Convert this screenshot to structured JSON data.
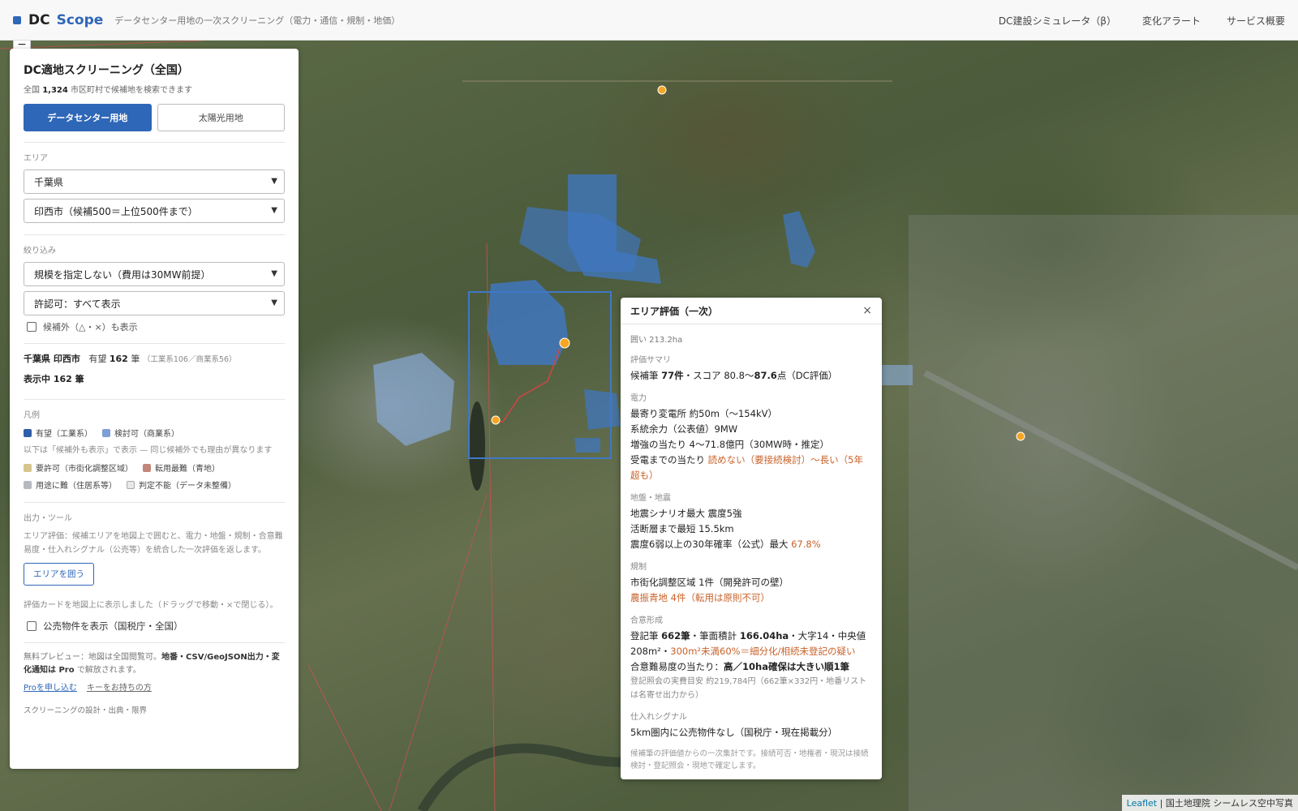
{
  "header": {
    "logo_dc": "DC",
    "logo_scope": "Scope",
    "tagline": "データセンター用地の一次スクリーニング（電力・通信・規制・地価）",
    "nav": [
      "DC建設シミュレータ（β）",
      "変化アラート",
      "サービス概要"
    ],
    "accent_color": "#2f67b8"
  },
  "map": {
    "zoom_minus": "−",
    "attribution_leaflet": "Leaflet",
    "attribution_rest": " | 国土地理院 シームレス空中写真"
  },
  "panel": {
    "title": "DC適地スクリーニング（全国）",
    "subtitle_prefix": "全国",
    "subtitle_count": "1,324",
    "subtitle_suffix": "市区町村で候補地を検索できます",
    "modes": [
      {
        "label": "データセンター用地",
        "active": true
      },
      {
        "label": "太陽光用地",
        "active": false
      }
    ],
    "area_label": "エリア",
    "prefecture": "千葉県",
    "city": "印西市（候補500＝上位500件まで）",
    "filter_label": "絞り込み",
    "scale": "規模を指定しない（費用は30MW前提）",
    "permit": "許認可：すべて表示",
    "show_excluded": "候補外（△・×）も表示",
    "summary_location": "千葉県 印西市",
    "summary_promising": "有望",
    "summary_count": "162",
    "summary_unit": "筆",
    "summary_breakdown": "（工業系106／商業系56）",
    "summary_showing": "表示中 162 筆",
    "legend_label": "凡例",
    "legend_primary": [
      {
        "label": "有望（工業系）",
        "color": "#2f5fa8"
      },
      {
        "label": "検討可（商業系）",
        "color": "#7d9fd4"
      }
    ],
    "legend_note": "以下は「候補外も表示」で表示 — 同じ候補外でも理由が異なります",
    "legend_secondary": [
      {
        "label": "要許可（市街化調整区域）",
        "color": "#d6c68c"
      },
      {
        "label": "転用最難（青地）",
        "color": "#c4857a"
      },
      {
        "label": "用途に難（住居系等）",
        "color": "#b7b9c0"
      },
      {
        "label": "判定不能（データ未整備）",
        "color": "#e8e8e8"
      }
    ],
    "tools_label": "出力・ツール",
    "tools_desc": "エリア評価：候補エリアを地図上で囲むと、電力・地盤・規制・合意難易度・仕入れシグナル（公売等）を統合した一次評価を返します。",
    "enclose_button": "エリアを囲う",
    "card_note": "評価カードを地図上に表示しました（ドラッグで移動・×で閉じる）。",
    "public_sale": "公売物件を表示（国税庁・全国）",
    "preview_prefix": "無料プレビュー：地図は全国閲覧可。",
    "preview_bold": "地番・CSV/GeoJSON出力・変化通知は Pro",
    "preview_suffix": "で解放されます。",
    "link_apply": "Proを申し込む",
    "link_key": "キーをお持ちの方",
    "footer": "スクリーニングの設計・出典・限界"
  },
  "eval": {
    "title": "エリア評価（一次）",
    "close": "×",
    "area": "囲い 213.2ha",
    "summary_h": "評価サマリ",
    "summary_pre": "候補筆",
    "summary_count": "77件",
    "summary_mid": "・スコア 80.8〜",
    "summary_max": "87.6",
    "summary_post": "点（DC評価）",
    "power_h": "電力",
    "power": [
      "最寄り変電所 約50m（〜154kV）",
      "系統余力（公表値）9MW",
      "増強の当たり 4〜71.8億円（30MW時・推定）"
    ],
    "power_wait_pre": "受電までの当たり",
    "power_wait_warn": "読めない（要接続検討）〜長い（5年超も）",
    "ground_h": "地盤・地震",
    "ground": [
      "地震シナリオ最大 震度5強",
      "活断層まで最短 15.5km"
    ],
    "ground_prob_pre": "震度6弱以上の30年確率（公式）最大",
    "ground_prob_val": "67.8%",
    "reg_h": "規制",
    "reg": "市街化調整区域 1件（開発許可の壁）",
    "reg_warn": "農振青地 4件（転用は原則不可）",
    "consent_h": "合意形成",
    "consent_pre": "登記筆",
    "consent_count": "662筆",
    "consent_mid": "・筆面積計",
    "consent_area": "166.04ha",
    "consent_post": "・大字14・中央値",
    "consent_median": "208m²・",
    "consent_warn": "300m²未満60%＝細分化/相続未登記の疑い",
    "consent_diff_pre": "合意難易度の当たり：",
    "consent_diff_bold": "高／10ha確保は大きい順1筆",
    "consent_cost": "登記照会の実費目安 約219,784円（662筆×332円・地番リストは名寄せ出力から）",
    "supply_h": "仕入れシグナル",
    "supply": "5km圏内に公売物件なし（国税庁・現在掲載分）",
    "foot": "候補筆の評価値からの一次集計です。接続可否・地権者・現況は接続検討・登記照会・現地で確定します。"
  }
}
